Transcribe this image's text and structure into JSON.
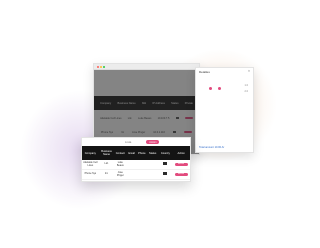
{
  "background": {
    "glow_left": "#decef0",
    "glow_right": "#f4decc"
  },
  "colors": {
    "accent": "#e24b7e",
    "header_dark": "#141414",
    "overlay": "#232323",
    "link": "#2e6ac9"
  },
  "back_window": {
    "url": "",
    "nav": [
      "",
      "",
      "",
      "",
      ""
    ],
    "table_headers": [
      "Company",
      "Business Name",
      "Kiki",
      "IP Address",
      "Status",
      "Private"
    ],
    "rows": [
      {
        "cells": [
          "Adelaide Cell Lines",
          "Ltd.",
          "Luke Beaus",
          "10.100.7.5",
          "",
          ""
        ]
      },
      {
        "cells": [
          "Phone Sys",
          "Int",
          "Jose Pinger",
          "10.0.1.116",
          "",
          ""
        ]
      }
    ]
  },
  "side_panel": {
    "title": "Detalles",
    "close_icon": "close-icon",
    "numbers": [
      "1.0",
      "2.0"
    ],
    "footer": "Total amount 10.00 Ar"
  },
  "front_dialog": {
    "tab_label": "Lista",
    "pill_label": "Accion",
    "headers": [
      "Company",
      "Business Name",
      "Contact",
      "Email",
      "Phone",
      "Status",
      "Country",
      "Action"
    ],
    "rows": [
      {
        "company": "Adelaide Cell Lines",
        "business": "Ltd.",
        "contact": "Luke Beaus",
        "email": "",
        "phone": "",
        "status": "",
        "action": "Accion"
      },
      {
        "company": "Phone Sys",
        "business": "Int.",
        "contact": "Jose Pinger",
        "email": "",
        "phone": "",
        "status": "",
        "action": "Accion"
      }
    ]
  }
}
